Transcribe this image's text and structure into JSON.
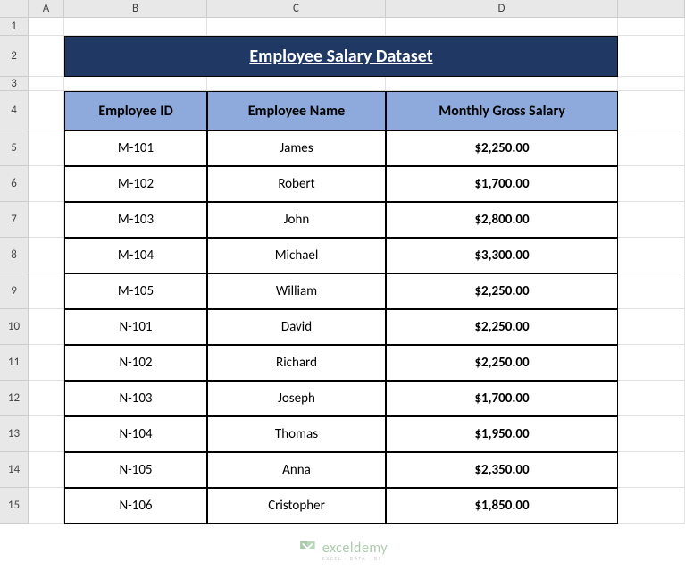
{
  "columns": {
    "a": "A",
    "b": "B",
    "c": "C",
    "d": "D"
  },
  "rowLabels": [
    "1",
    "2",
    "3",
    "4",
    "5",
    "6",
    "7",
    "8",
    "9",
    "10",
    "11",
    "12",
    "13",
    "14",
    "15"
  ],
  "title": "Employee Salary Dataset",
  "headers": {
    "id": "Employee ID",
    "name": "Employee Name",
    "salary": "Monthly Gross Salary"
  },
  "rows": [
    {
      "id": "M-101",
      "name": "James",
      "salary": "$2,250.00"
    },
    {
      "id": "M-102",
      "name": "Robert",
      "salary": "$1,700.00"
    },
    {
      "id": "M-103",
      "name": "John",
      "salary": "$2,800.00"
    },
    {
      "id": "M-104",
      "name": "Michael",
      "salary": "$3,300.00"
    },
    {
      "id": "M-105",
      "name": "William",
      "salary": "$2,250.00"
    },
    {
      "id": "N-101",
      "name": "David",
      "salary": "$2,250.00"
    },
    {
      "id": "N-102",
      "name": "Richard",
      "salary": "$2,250.00"
    },
    {
      "id": "N-103",
      "name": "Joseph",
      "salary": "$1,700.00"
    },
    {
      "id": "N-104",
      "name": "Thomas",
      "salary": "$1,950.00"
    },
    {
      "id": "N-105",
      "name": "Anna",
      "salary": "$2,350.00"
    },
    {
      "id": "N-106",
      "name": "Cristopher",
      "salary": "$1,850.00"
    }
  ],
  "watermark": {
    "main": "exceldemy",
    "sub": "EXCEL · DATA · BI"
  }
}
